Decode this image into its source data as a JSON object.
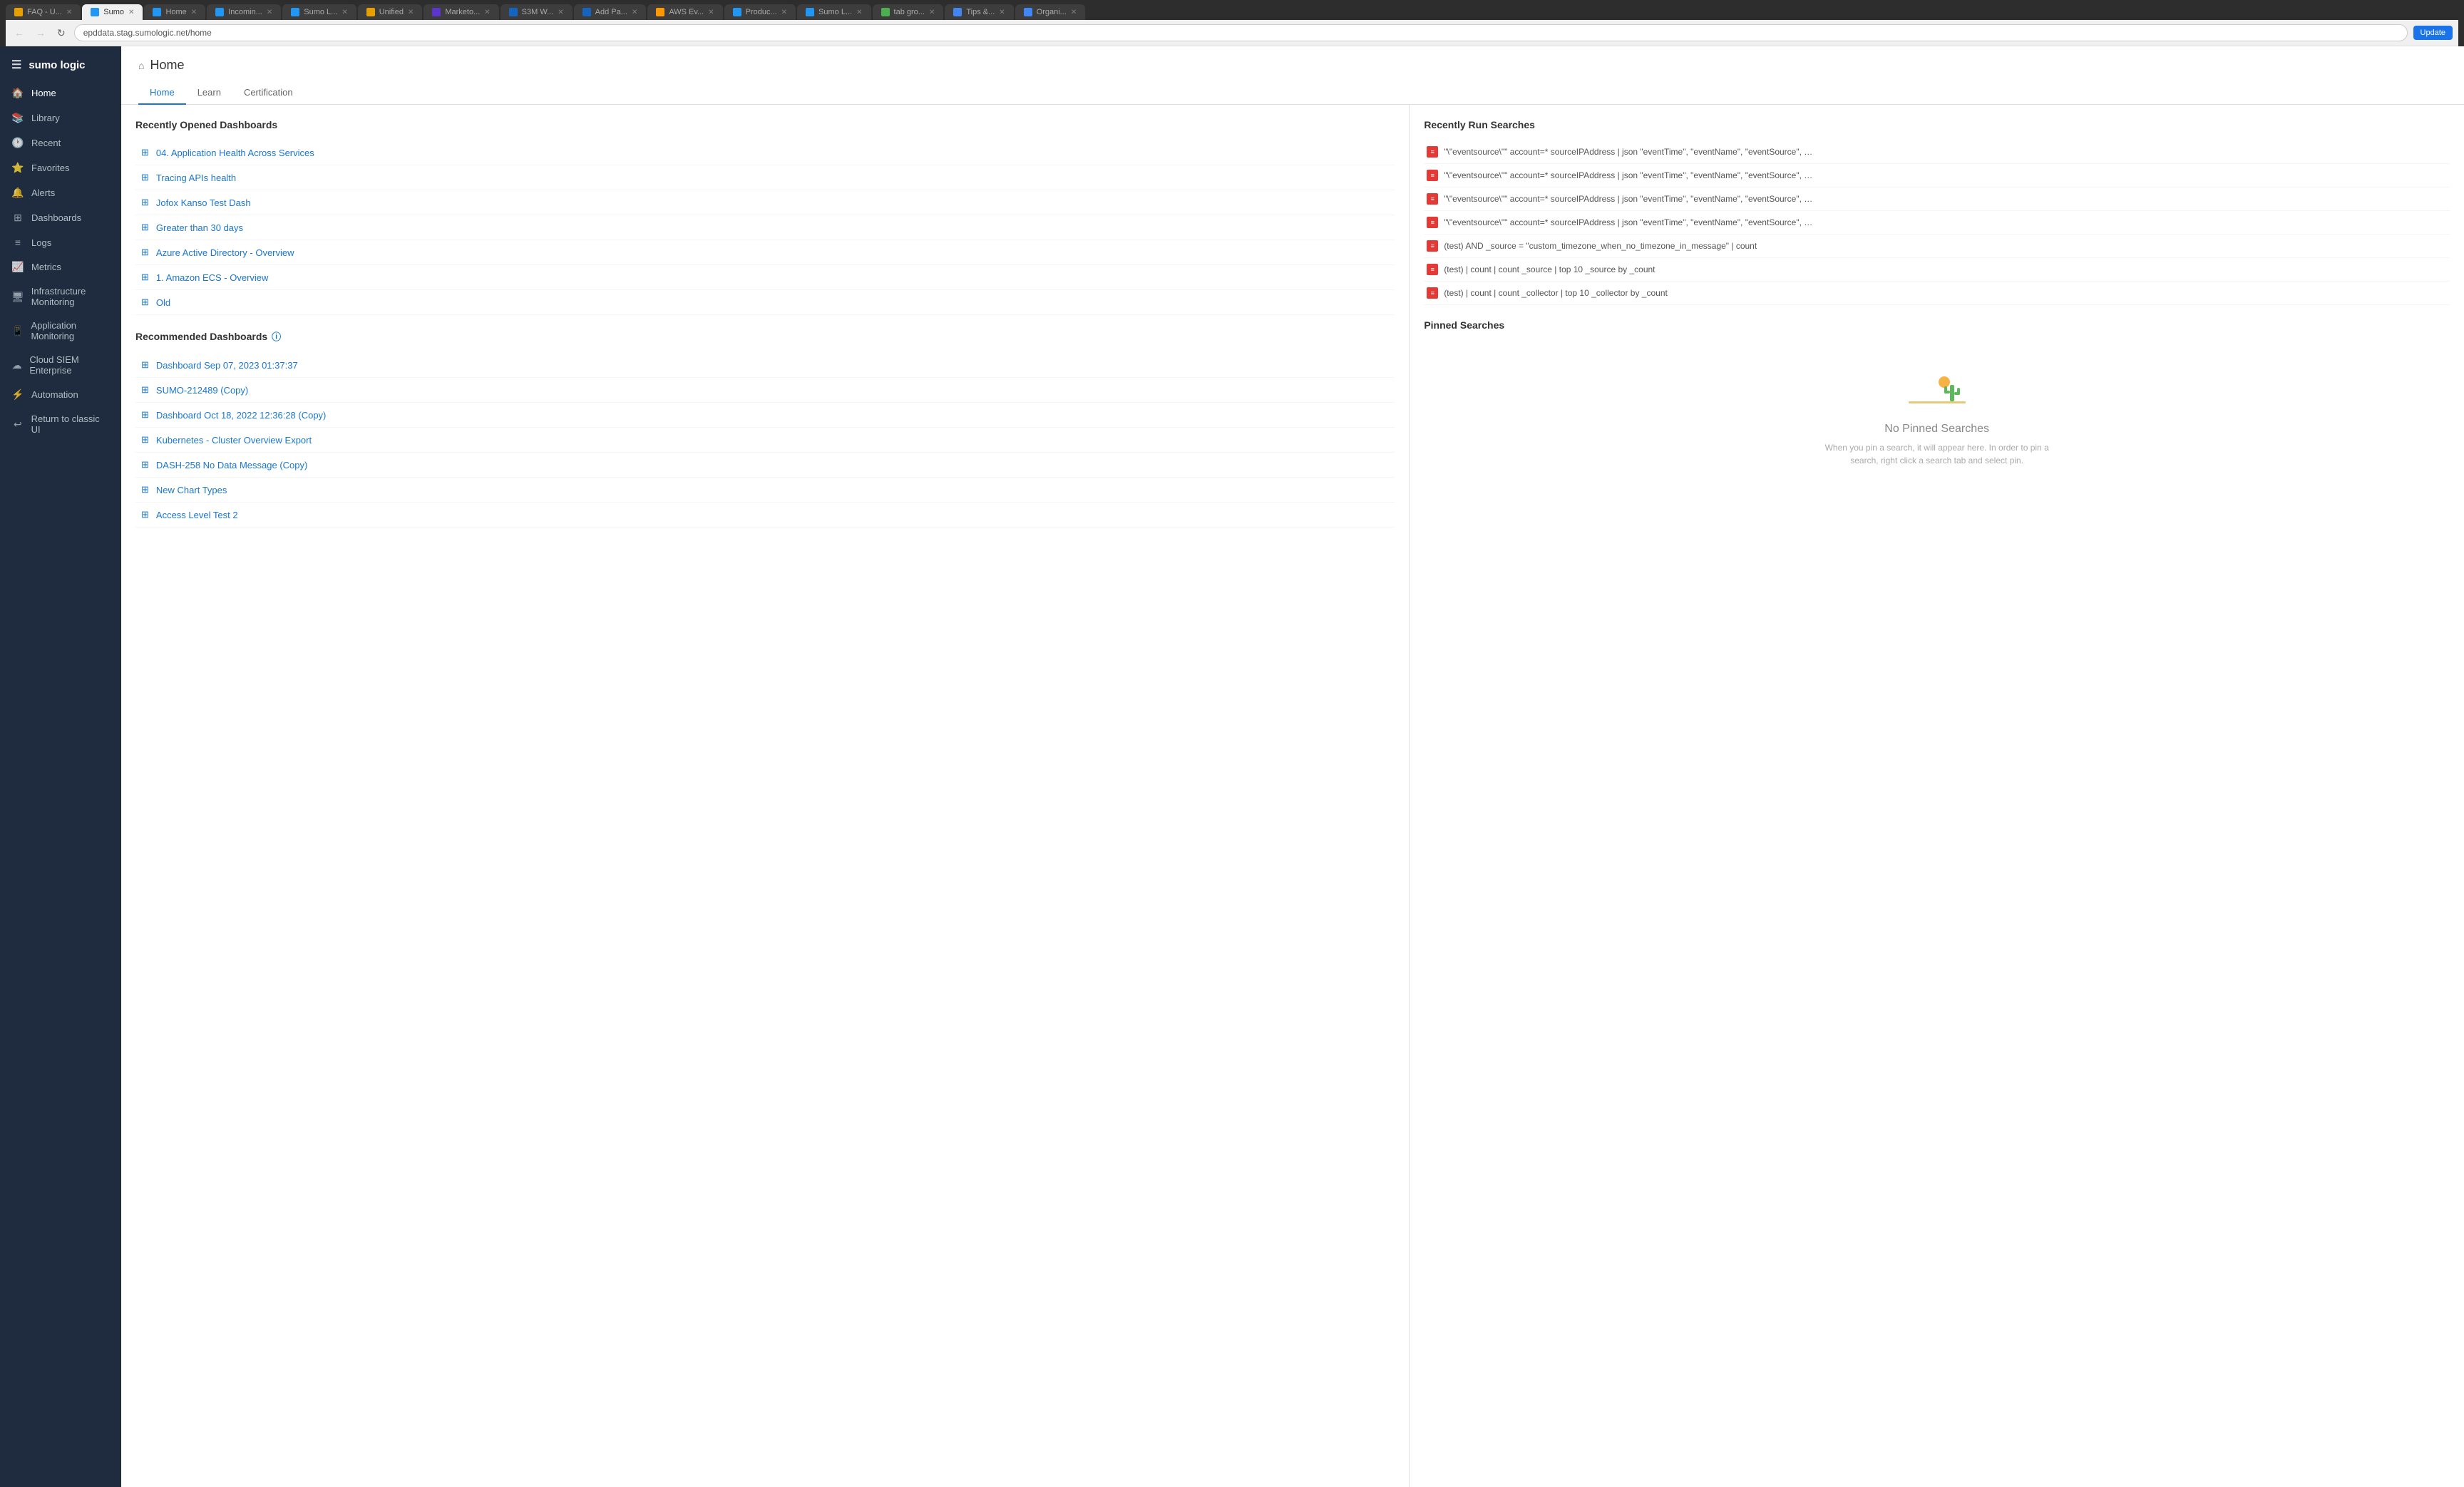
{
  "browser": {
    "tabs": [
      {
        "id": "faq",
        "label": "FAQ - U...",
        "active": false,
        "favicon_color": "#e8a000"
      },
      {
        "id": "sumo",
        "label": "Sumo",
        "active": true,
        "favicon_color": "#2196f3"
      },
      {
        "id": "home",
        "label": "Home",
        "active": false,
        "favicon_color": "#2196f3"
      },
      {
        "id": "incoming",
        "label": "Incomin...",
        "active": false,
        "favicon_color": "#2196f3"
      },
      {
        "id": "sumol",
        "label": "Sumo L...",
        "active": false,
        "favicon_color": "#2196f3"
      },
      {
        "id": "unified",
        "label": "Unified",
        "active": false,
        "favicon_color": "#e8a000"
      },
      {
        "id": "market",
        "label": "Marketo...",
        "active": false,
        "favicon_color": "#5c35cc"
      },
      {
        "id": "s3m",
        "label": "S3M W...",
        "active": false,
        "favicon_color": "#1565c0"
      },
      {
        "id": "addpa",
        "label": "Add Pa...",
        "active": false,
        "favicon_color": "#1565c0"
      },
      {
        "id": "awsev",
        "label": "AWS Ev...",
        "active": false,
        "favicon_color": "#ff9800"
      },
      {
        "id": "produ",
        "label": "Produc...",
        "active": false,
        "favicon_color": "#2196f3"
      },
      {
        "id": "sumol2",
        "label": "Sumo L...",
        "active": false,
        "favicon_color": "#2196f3"
      },
      {
        "id": "tabgro",
        "label": "tab gro...",
        "active": false,
        "favicon_color": "#4caf50"
      },
      {
        "id": "tips",
        "label": "Tips &...",
        "active": false,
        "favicon_color": "#4285f4"
      },
      {
        "id": "organi",
        "label": "Organi...",
        "active": false,
        "favicon_color": "#4285f4"
      }
    ],
    "address": "epddata.stag.sumologic.net/home"
  },
  "sidebar": {
    "logo": "sumo logic",
    "items": [
      {
        "id": "home",
        "label": "Home",
        "icon": "🏠",
        "active": true
      },
      {
        "id": "library",
        "label": "Library",
        "icon": "📚",
        "active": false
      },
      {
        "id": "recent",
        "label": "Recent",
        "icon": "🕐",
        "active": false
      },
      {
        "id": "favorites",
        "label": "Favorites",
        "icon": "⭐",
        "active": false
      },
      {
        "id": "alerts",
        "label": "Alerts",
        "icon": "🔔",
        "active": false
      },
      {
        "id": "dashboards",
        "label": "Dashboards",
        "icon": "⊞",
        "active": false
      },
      {
        "id": "logs",
        "label": "Logs",
        "icon": "≡",
        "active": false
      },
      {
        "id": "metrics",
        "label": "Metrics",
        "icon": "📈",
        "active": false
      },
      {
        "id": "infra",
        "label": "Infrastructure Monitoring",
        "icon": "🖥",
        "active": false
      },
      {
        "id": "appmon",
        "label": "Application Monitoring",
        "icon": "📱",
        "active": false
      },
      {
        "id": "cloud",
        "label": "Cloud SIEM Enterprise",
        "icon": "☁",
        "active": false
      },
      {
        "id": "automation",
        "label": "Automation",
        "icon": "⚡",
        "active": false
      },
      {
        "id": "return",
        "label": "Return to classic UI",
        "icon": "↩",
        "active": false
      }
    ]
  },
  "page": {
    "title": "Home",
    "tabs": [
      {
        "id": "home",
        "label": "Home",
        "active": true
      },
      {
        "id": "learn",
        "label": "Learn",
        "active": false
      },
      {
        "id": "certification",
        "label": "Certification",
        "active": false
      }
    ]
  },
  "recently_opened": {
    "title": "Recently Opened Dashboards",
    "items": [
      {
        "id": 1,
        "name": "04. Application Health Across Services"
      },
      {
        "id": 2,
        "name": "Tracing APIs health"
      },
      {
        "id": 3,
        "name": "Jofox Kanso Test Dash"
      },
      {
        "id": 4,
        "name": "Greater than 30 days"
      },
      {
        "id": 5,
        "name": "Azure Active Directory - Overview"
      },
      {
        "id": 6,
        "name": "1. Amazon ECS - Overview"
      },
      {
        "id": 7,
        "name": "Old"
      }
    ]
  },
  "recommended": {
    "title": "Recommended Dashboards",
    "items": [
      {
        "id": 1,
        "name": "Dashboard Sep 07, 2023 01:37:37"
      },
      {
        "id": 2,
        "name": "SUMO-212489 (Copy)"
      },
      {
        "id": 3,
        "name": "Dashboard Oct 18, 2022 12:36:28 (Copy)"
      },
      {
        "id": 4,
        "name": "Kubernetes - Cluster Overview Export"
      },
      {
        "id": 5,
        "name": "DASH-258 No Data Message (Copy)"
      },
      {
        "id": 6,
        "name": "New Chart Types"
      },
      {
        "id": 7,
        "name": "Access Level Test 2"
      }
    ]
  },
  "recently_run_searches": {
    "title": "Recently Run Searches",
    "items": [
      {
        "id": 1,
        "text": "\"\\\"eventsource\\\"\" account=* sourceIPAddress | json \"eventTime\", \"eventName\", \"eventSource\", \"awsRegion\", \"..."
      },
      {
        "id": 2,
        "text": "\"\\\"eventsource\\\"\" account=* sourceIPAddress | json \"eventTime\", \"eventName\", \"eventSource\", \"awsRegion\", \"..."
      },
      {
        "id": 3,
        "text": "\"\\\"eventsource\\\"\" account=* sourceIPAddress | json \"eventTime\", \"eventName\", \"eventSource\", \"awsRegion\", \"..."
      },
      {
        "id": 4,
        "text": "\"\\\"eventsource\\\"\" account=* sourceIPAddress | json \"eventTime\", \"eventName\", \"eventSource\", \"awsRegion\", \"..."
      },
      {
        "id": 5,
        "text": "(test) AND _source = \"custom_timezone_when_no_timezone_in_message\" | count"
      },
      {
        "id": 6,
        "text": "(test) | count | count _source | top 10 _source by _count"
      },
      {
        "id": 7,
        "text": "(test) | count | count _collector | top 10 _collector by _count"
      }
    ]
  },
  "pinned_searches": {
    "title": "Pinned Searches",
    "empty": true,
    "empty_title": "No Pinned Searches",
    "empty_desc": "When you pin a search, it will appear here. In order to pin a search, right click a search tab and select pin."
  }
}
